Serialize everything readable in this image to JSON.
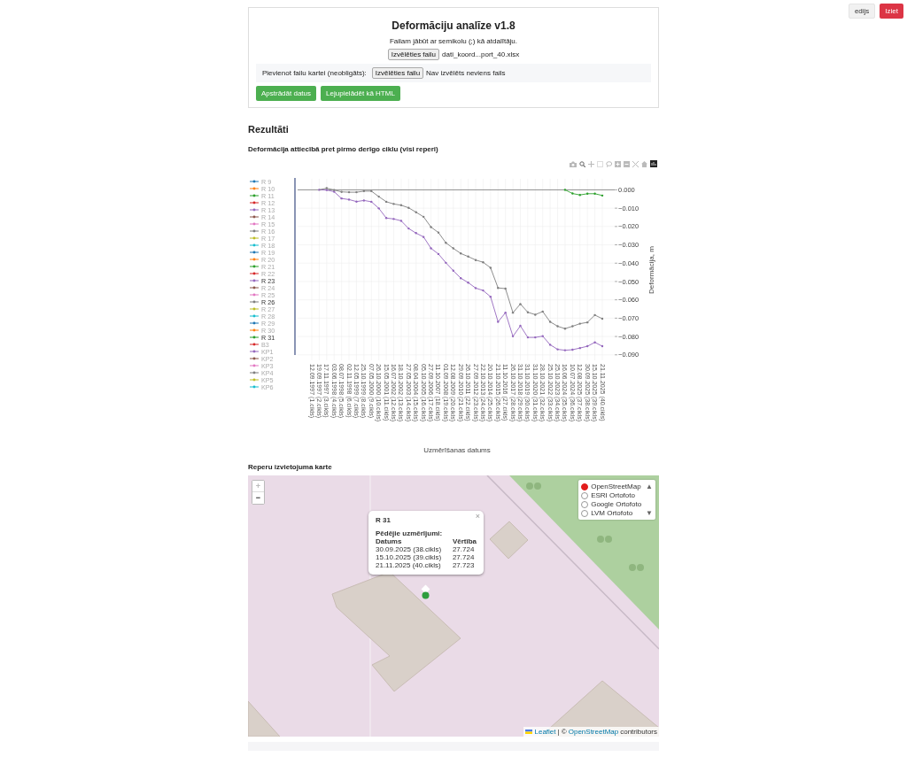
{
  "header": {
    "buttons": [
      {
        "label": "edijs",
        "kind": "secondary"
      },
      {
        "label": "Iziet",
        "kind": "danger"
      }
    ]
  },
  "upload_card": {
    "title": "Deformāciju analīze v1.8",
    "hint": "Failam jābūt ar semikolu (;) kā atdalītāju.",
    "file_input": {
      "button": "Izvēlēties failu",
      "file_name": "dati_koord...port_40.xlsx"
    },
    "map_file": {
      "label": "Pievienot failu kartei (neobligāts):",
      "button": "Izvēlēties failu",
      "file_name": "Nav izvēlēts neviens fails"
    },
    "actions": [
      "Apstrādāt datus",
      "Lejupielādēt kā HTML"
    ]
  },
  "results": {
    "heading": "Rezultāti",
    "chart_title": "Deformācija attiecībā pret pirmo derīgo ciklu (visi reperi)",
    "chart_data": {
      "type": "line",
      "xlabel": "Uzmērīšanas datums",
      "ylabel": "Deformācija, m",
      "grid": true,
      "legend": {
        "items": [
          {
            "name": "R 9",
            "color": "#1f77b4",
            "visible": false
          },
          {
            "name": "R 10",
            "color": "#ff7f0e",
            "visible": false
          },
          {
            "name": "R 11",
            "color": "#2ca02c",
            "visible": false
          },
          {
            "name": "R 12",
            "color": "#d62728",
            "visible": false
          },
          {
            "name": "R 13",
            "color": "#9467bd",
            "visible": false
          },
          {
            "name": "R 14",
            "color": "#8c564b",
            "visible": false
          },
          {
            "name": "R 15",
            "color": "#e377c2",
            "visible": false
          },
          {
            "name": "R 16",
            "color": "#7f7f7f",
            "visible": false
          },
          {
            "name": "R 17",
            "color": "#bcbd22",
            "visible": false
          },
          {
            "name": "R 18",
            "color": "#17becf",
            "visible": false
          },
          {
            "name": "R 19",
            "color": "#1f77b4",
            "visible": false
          },
          {
            "name": "R 20",
            "color": "#ff7f0e",
            "visible": false
          },
          {
            "name": "R 21",
            "color": "#2ca02c",
            "visible": false
          },
          {
            "name": "R 22",
            "color": "#d62728",
            "visible": false
          },
          {
            "visible": true
          },
          {
            "name": "R 24",
            "color": "#8c564b",
            "visible": false
          },
          {
            "name": "R 25",
            "color": "#e377c2",
            "visible": false
          },
          {
            "visible": true
          },
          {
            "name": "R 27",
            "color": "#bcbd22",
            "visible": false
          },
          {
            "name": "R 28",
            "color": "#17becf",
            "visible": false
          },
          {
            "name": "R 29",
            "color": "#1f77b4",
            "visible": false
          },
          {
            "name": "R 30",
            "color": "#ff7f0e",
            "visible": false
          },
          {
            "visible": true
          },
          {
            "name": "B3",
            "color": "#d62728",
            "visible": false
          },
          {
            "name": "KP1",
            "color": "#9467bd",
            "visible": false
          },
          {
            "name": "KP2",
            "color": "#8c564b",
            "visible": false
          },
          {
            "name": "KP3",
            "color": "#e377c2",
            "visible": false
          },
          {
            "name": "KP4",
            "color": "#7f7f7f",
            "visible": false
          },
          {
            "name": "KP5",
            "color": "#bcbd22",
            "visible": false
          },
          {
            "name": "KP6",
            "color": "#17becf",
            "visible": false
          }
        ]
      },
      "categories": [
        "12.09.1997 (1.cikls)",
        "19.09.1997 (2.cikls)",
        "17.11.1997 (3.cikls)",
        "03.06.1998 (4.cikls)",
        "08.07.1998 (5.cikls)",
        "02.11.1998 (6.cikls)",
        "12.05.1999 (7.cikls)",
        "25.10.1999 (8.cikls)",
        "07.05.2000 (9.cikls)",
        "26.10.2000 (10.cikls)",
        "15.05.2001 (11.cikls)",
        "16.07.2002 (12.cikls)",
        "18.10.2002 (13.cikls)",
        "27.05.2003 (14.cikls)",
        "08.04.2004 (15.cikls)",
        "05.10.2005 (16.cikls)",
        "27.09.2006 (17.cikls)",
        "11.10.2007 (18.cikls)",
        "01.09.2008 (19.cikls)",
        "12.08.2009 (20.cikls)",
        "29.09.2010 (21.cikls)",
        "26.10.2011 (22.cikls)",
        "27.09.2012 (23.cikls)",
        "22.10.2013 (24.cikls)",
        "20.10.2014 (25.cikls)",
        "21.10.2015 (26.cikls)",
        "11.10.2016 (27.cikls)",
        "26.10.2017 (28.cikls)",
        "31.10.2018 (29.cikls)",
        "31.10.2019 (30.cikls)",
        "31.10.2020 (31.cikls)",
        "28.10.2021 (32.cikls)",
        "25.10.2022 (33.cikls)",
        "25.10.2023 (34.cikls)",
        "16.06.2024 (35.cikls)",
        "10.07.2024 (36.cikls)",
        "12.08.2025 (37.cikls)",
        "30.09.2025 (38.cikls)",
        "15.10.2025 (39.cikls)",
        "21.11.2025 (40.cikls)"
      ],
      "series": [
        {
          "name": "R 23",
          "color": "#9467bd",
          "values": [
            null,
            0,
            -0.0001,
            -0.001,
            -0.0047,
            -0.0053,
            -0.0064,
            -0.0058,
            -0.0065,
            -0.0101,
            -0.0154,
            -0.0159,
            -0.0169,
            -0.0211,
            -0.0236,
            -0.0257,
            -0.0319,
            -0.035,
            -0.0398,
            -0.0441,
            -0.0482,
            -0.0506,
            -0.0536,
            -0.0549,
            -0.0583,
            -0.072,
            -0.067,
            -0.0799,
            -0.0742,
            -0.0805,
            -0.0805,
            -0.0798,
            -0.0845,
            -0.087,
            -0.0875,
            -0.0872,
            -0.0863,
            -0.0853,
            -0.0832,
            -0.0853
          ]
        },
        {
          "name": "R 26",
          "color": "#7f7f7f",
          "values": [
            null,
            0,
            0.0009,
            -0.0001,
            -0.0011,
            -0.0013,
            -0.0013,
            -0.0007,
            -0.0007,
            -0.0037,
            -0.0065,
            -0.0077,
            -0.0084,
            -0.0098,
            -0.0122,
            -0.0147,
            -0.0203,
            -0.0233,
            -0.0289,
            -0.0319,
            -0.0347,
            -0.0364,
            -0.0383,
            -0.0395,
            -0.0425,
            -0.0535,
            -0.0539,
            -0.067,
            -0.0623,
            -0.0668,
            -0.0681,
            -0.0664,
            -0.072,
            -0.0744,
            -0.0757,
            -0.0744,
            -0.073,
            -0.0723,
            -0.0683,
            -0.0703
          ]
        },
        {
          "name": "R 31",
          "color": "#2ca02c",
          "values": [
            null,
            null,
            null,
            null,
            null,
            null,
            null,
            null,
            null,
            null,
            null,
            null,
            null,
            null,
            null,
            null,
            null,
            null,
            null,
            null,
            null,
            null,
            null,
            null,
            null,
            null,
            null,
            null,
            null,
            null,
            null,
            null,
            null,
            null,
            0,
            -0.002,
            -0.0028,
            -0.0021,
            -0.0021,
            -0.0031
          ]
        }
      ],
      "ylim": [
        -0.093,
        0.006
      ],
      "yticks": [
        {
          "value": 0,
          "label": "0.000"
        },
        {
          "value": -0.01,
          "label": "−0.010"
        },
        {
          "value": -0.02,
          "label": "−0.020"
        },
        {
          "value": -0.03,
          "label": "−0.030"
        },
        {
          "value": -0.04,
          "label": "−0.040"
        },
        {
          "value": -0.05,
          "label": "−0.050"
        },
        {
          "value": -0.06,
          "label": "−0.060"
        },
        {
          "value": -0.07,
          "label": "−0.070"
        },
        {
          "value": -0.08,
          "label": "−0.080"
        },
        {
          "value": -0.09,
          "label": "−0.090"
        }
      ]
    }
  },
  "map": {
    "title": "Reperu izvietojuma karte",
    "zoom_buttons": [
      {
        "label": "+",
        "disabled": true
      },
      {
        "label": "−",
        "disabled": false
      }
    ],
    "layers": [
      {
        "label": "OpenStreetMap",
        "selected": true
      },
      {
        "label": "ESRI Ortofoto",
        "selected": false
      },
      {
        "label": "Google Ortofoto",
        "selected": false
      },
      {
        "label": "LVM Ortofoto",
        "selected": false
      }
    ],
    "layer_scroll": [
      "▲",
      "▼"
    ],
    "popup": {
      "title": "R 31",
      "close": "×",
      "subtitle": "Pēdējie uzmērījumi:",
      "columns": [
        "Datums",
        "Vērtība"
      ],
      "rows": [
        [
          "30.09.2025 (38.cikls)",
          "27.724"
        ],
        [
          "15.10.2025 (39.cikls)",
          "27.724"
        ],
        [
          "21.11.2025 (40.cikls)",
          "27.723"
        ]
      ]
    },
    "attribution": {
      "leaflet": "Leaflet",
      "separator": "| ©",
      "osm": "OpenStreetMap",
      "suffix": "contributors"
    }
  }
}
